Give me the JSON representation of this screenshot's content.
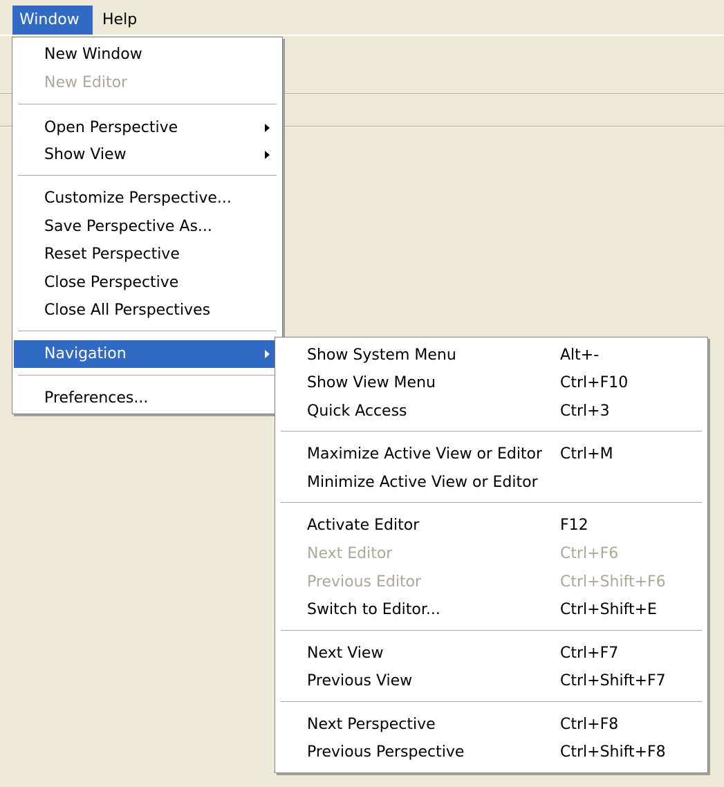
{
  "menubar": {
    "window": "Window",
    "help": "Help"
  },
  "window_menu": {
    "new_window": "New Window",
    "new_editor": "New Editor",
    "open_perspective": "Open Perspective",
    "show_view": "Show View",
    "customize_perspective": "Customize Perspective...",
    "save_perspective_as": "Save Perspective As...",
    "reset_perspective": "Reset Perspective",
    "close_perspective": "Close Perspective",
    "close_all_perspectives": "Close All Perspectives",
    "navigation": "Navigation",
    "preferences": "Preferences..."
  },
  "navigation_menu": {
    "show_system_menu": {
      "label": "Show System Menu",
      "shortcut": "Alt+-"
    },
    "show_view_menu": {
      "label": "Show View Menu",
      "shortcut": "Ctrl+F10"
    },
    "quick_access": {
      "label": "Quick Access",
      "shortcut": "Ctrl+3"
    },
    "maximize_active": {
      "label": "Maximize Active View or Editor",
      "shortcut": "Ctrl+M"
    },
    "minimize_active": {
      "label": "Minimize Active View or Editor",
      "shortcut": ""
    },
    "activate_editor": {
      "label": "Activate Editor",
      "shortcut": "F12"
    },
    "next_editor": {
      "label": "Next Editor",
      "shortcut": "Ctrl+F6"
    },
    "previous_editor": {
      "label": "Previous Editor",
      "shortcut": "Ctrl+Shift+F6"
    },
    "switch_to_editor": {
      "label": "Switch to Editor...",
      "shortcut": "Ctrl+Shift+E"
    },
    "next_view": {
      "label": "Next View",
      "shortcut": "Ctrl+F7"
    },
    "previous_view": {
      "label": "Previous View",
      "shortcut": "Ctrl+Shift+F7"
    },
    "next_perspective": {
      "label": "Next Perspective",
      "shortcut": "Ctrl+F8"
    },
    "previous_perspective": {
      "label": "Previous Perspective",
      "shortcut": "Ctrl+Shift+F8"
    }
  },
  "colors": {
    "background": "#ece9d8",
    "selection": "#316ac5",
    "disabled_text": "#aca899"
  }
}
